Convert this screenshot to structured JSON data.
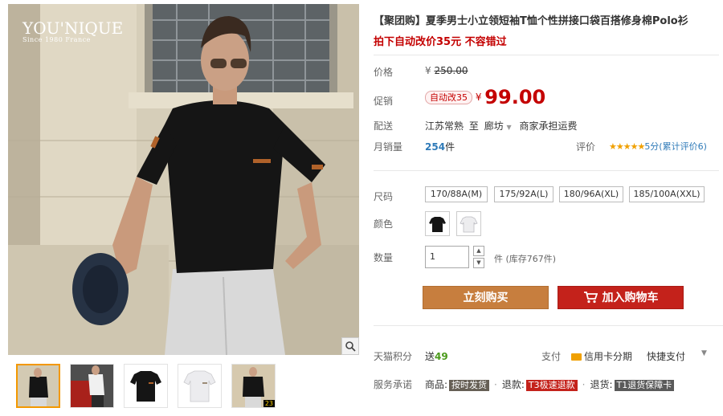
{
  "gallery": {
    "brand_name": "YOU'NIQUE",
    "brand_sub": "Since 1980 France",
    "thumbnail_badge": "23"
  },
  "product": {
    "title": "【聚团购】夏季男士小立领短袖T恤个性拼接口袋百搭修身棉Polo衫",
    "subtitle_prefix": "拍下自动改价",
    "subtitle_price": "35元",
    "subtitle_suffix": " 不容错过"
  },
  "price": {
    "label": "价格",
    "currency": "¥",
    "original": "250.00"
  },
  "promo": {
    "label": "促销",
    "tag": "自动改35",
    "currency": "¥",
    "price": "99.00"
  },
  "shipping": {
    "label": "配送",
    "origin": "江苏常熟",
    "to": "至",
    "destination": "廊坊",
    "fee": "商家承担运费"
  },
  "sales": {
    "label": "月销量",
    "count": "254",
    "unit": "件",
    "rating_label": "评价",
    "stars": "★★★★★",
    "score": "5分(累计评价6)"
  },
  "options": {
    "size_label": "尺码",
    "sizes": [
      "170/88A(M)",
      "175/92A(L)",
      "180/96A(XL)",
      "185/100A(XXL)"
    ],
    "color_label": "颜色",
    "colors": [
      "#151515",
      "#ededef"
    ]
  },
  "quantity": {
    "label": "数量",
    "value": "1",
    "unit": "件",
    "stock": "(库存767件)"
  },
  "buttons": {
    "buy_now": "立刻购买",
    "add_to_cart": "加入购物车"
  },
  "points": {
    "label": "天猫积分",
    "prefix": "送",
    "value": "49",
    "pay_label": "支付",
    "installment": "信用卡分期",
    "quick_pay": "快捷支付"
  },
  "service": {
    "label": "服务承诺",
    "items": [
      {
        "name": "商品:",
        "tag": "按时发货"
      },
      {
        "name": "退款:",
        "tag": "T3极速退款"
      },
      {
        "name": "退货:",
        "tag": "T1退货保障卡"
      }
    ]
  },
  "colors": {
    "price_red": "#c40000",
    "buy_button": "#c77e3e",
    "cart_button": "#c4221b",
    "link_blue": "#2e7ab8",
    "star_orange": "#f0a000"
  }
}
